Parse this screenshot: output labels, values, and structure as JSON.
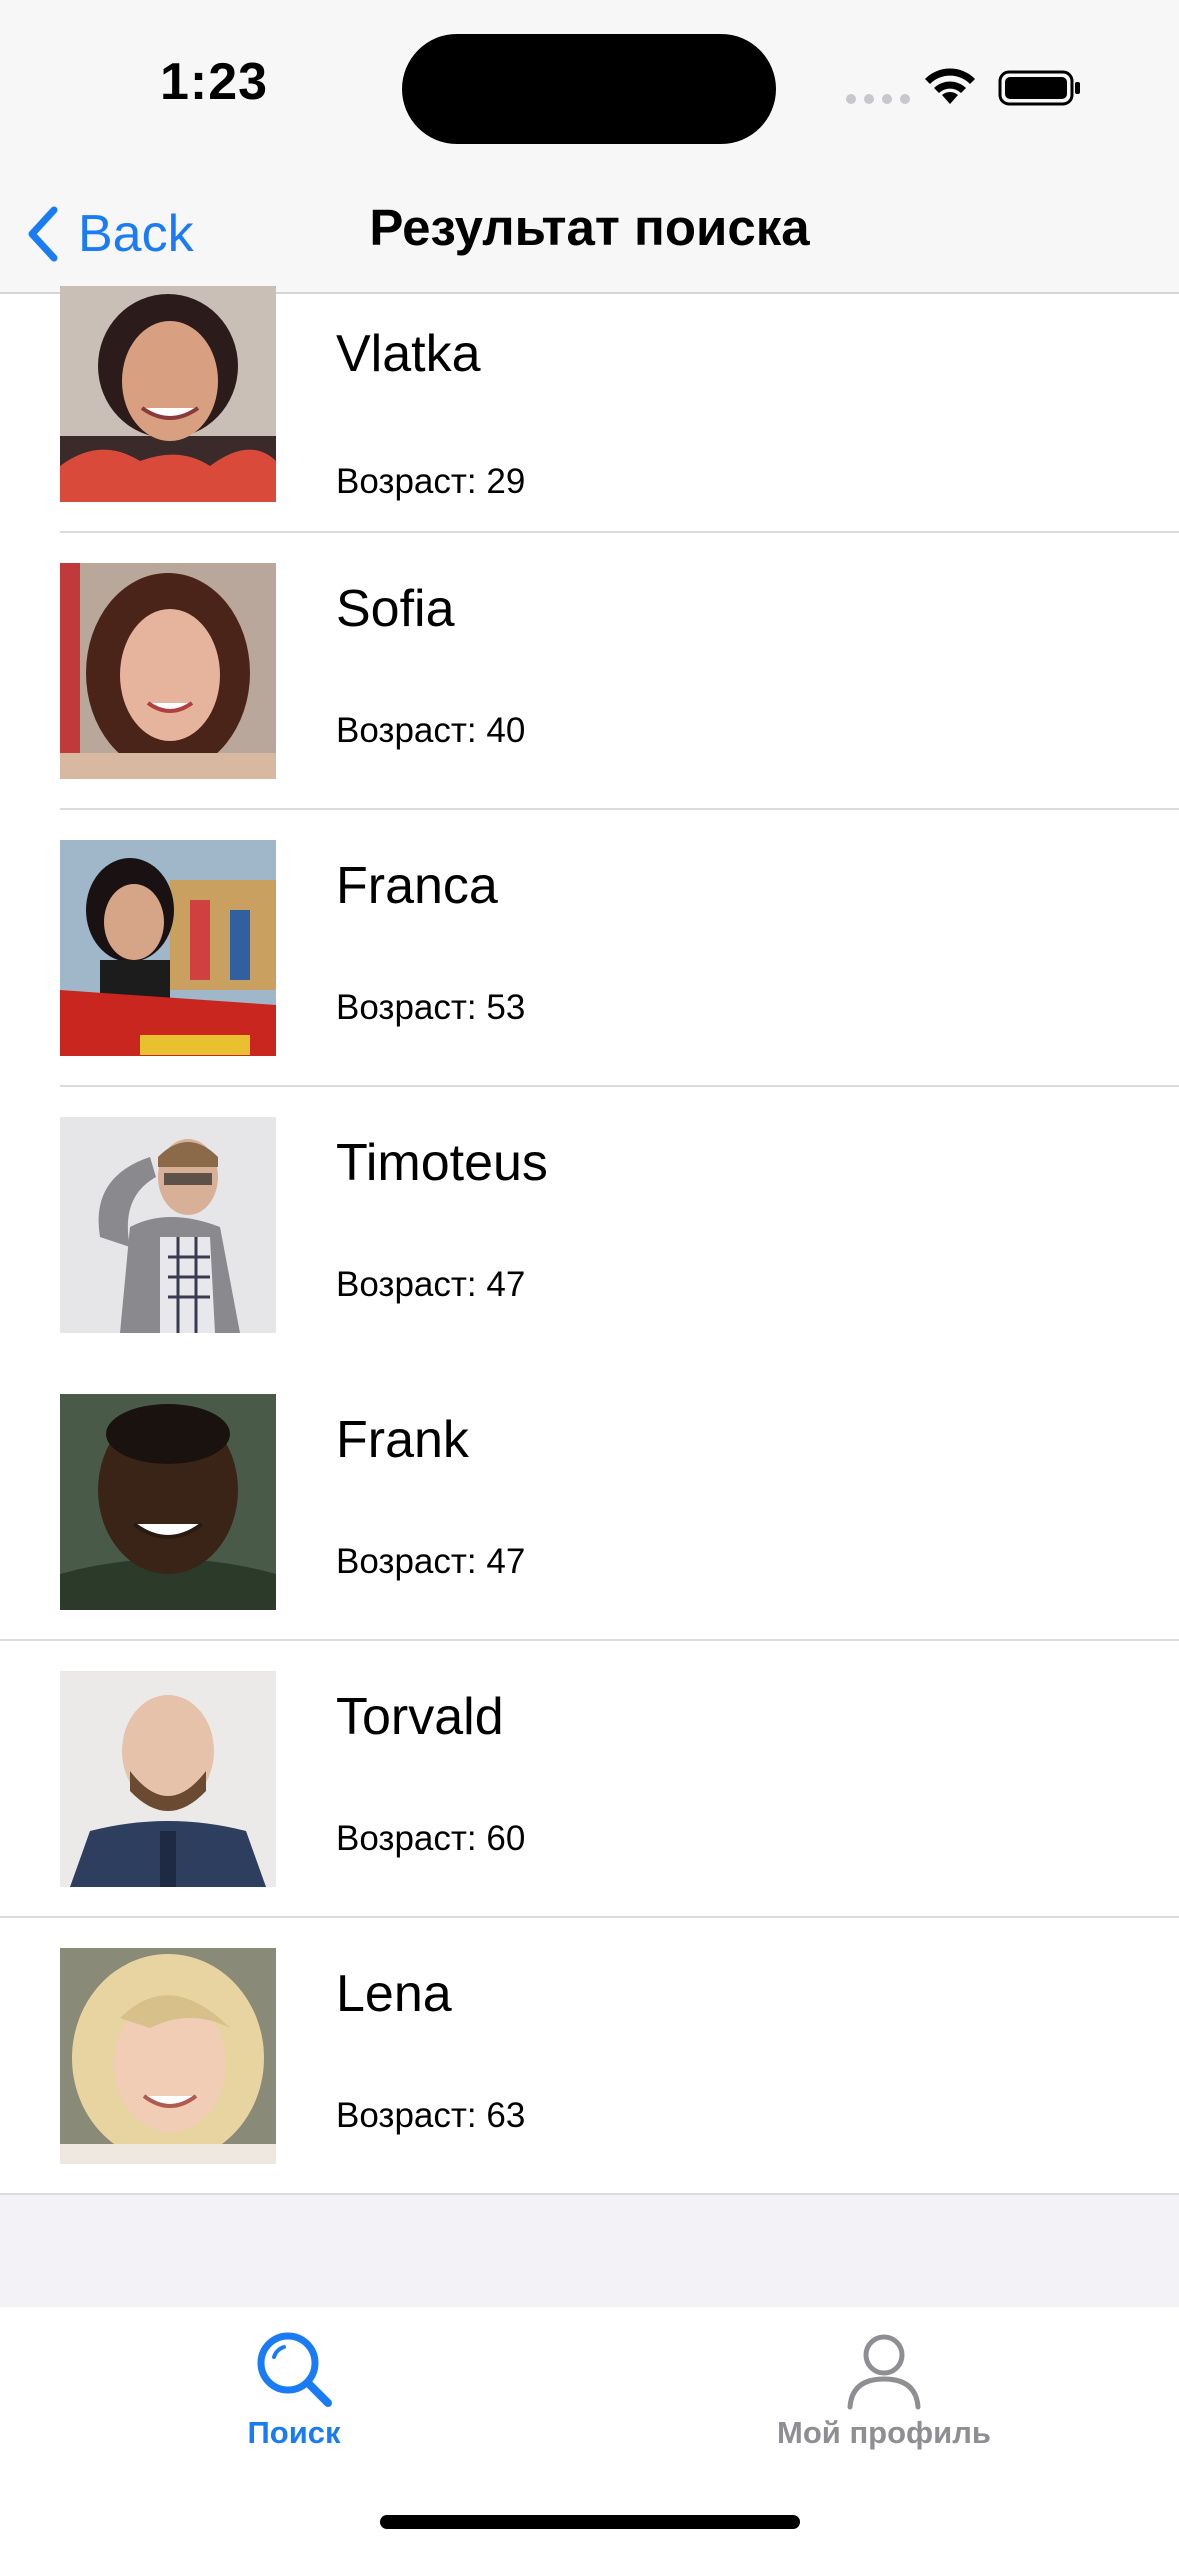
{
  "status_bar": {
    "time": "1:23"
  },
  "nav": {
    "back_label": "Back",
    "title": "Результат поиска"
  },
  "results": [
    {
      "name": "Vlatka",
      "age": "Возраст: 29"
    },
    {
      "name": "Sofia",
      "age": "Возраст: 40"
    },
    {
      "name": "Franca",
      "age": "Возраст: 53"
    },
    {
      "name": "Timoteus",
      "age": "Возраст: 47"
    },
    {
      "name": "Frank",
      "age": "Возраст: 47"
    },
    {
      "name": "Torvald",
      "age": "Возраст: 60"
    },
    {
      "name": "Lena",
      "age": "Возраст: 63"
    }
  ],
  "tab_bar": {
    "tabs": [
      {
        "label": "Поиск",
        "icon": "magnifier-icon",
        "selected": true
      },
      {
        "label": "Мой профиль",
        "icon": "person-icon",
        "selected": false
      }
    ]
  },
  "colors": {
    "accent": "#1a7cf5",
    "inactive": "#8e8e93",
    "bar_background": "#f7f7f7"
  }
}
